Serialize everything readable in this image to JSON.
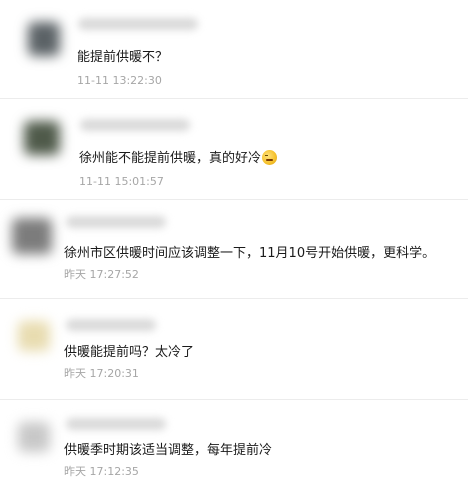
{
  "comments": [
    {
      "text": "能提前供暖不？",
      "time": "11-11 13:22:30",
      "avatar_color": "#5b6266"
    },
    {
      "text": "徐州能不能提前供暖，真的好冷",
      "emoji": "cold-face-emoji",
      "time": "11-11 15:01:57",
      "avatar_color": "#4f5a4a"
    },
    {
      "text": "徐州市区供暖时间应该调整一下，11月10号开始供暖，更科学。",
      "time": "昨天 17:27:52",
      "avatar_color": "#7c7c7c"
    },
    {
      "text": "供暖能提前吗？太冷了",
      "time": "昨天 17:20:31",
      "avatar_color": "#e8dcb0"
    },
    {
      "text": "供暖季时期该适当调整，每年提前冷",
      "time": "昨天 17:12:35",
      "avatar_color": "#c8c8c8"
    }
  ]
}
